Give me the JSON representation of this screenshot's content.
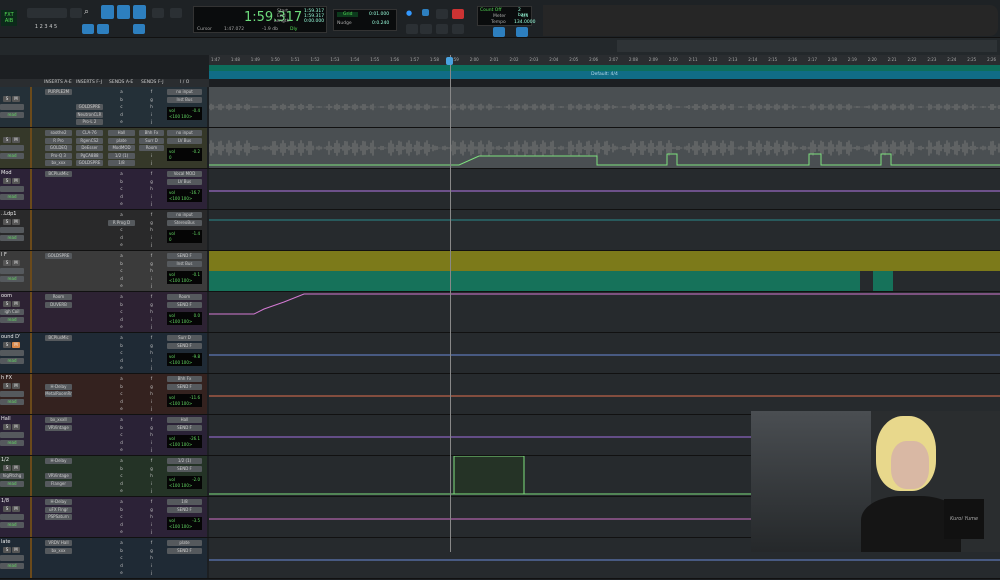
{
  "toolbar": {
    "mode_top": "FXT",
    "mode_bottom": "AIB",
    "zoom_presets": [
      "1",
      "2",
      "3",
      "4",
      "5"
    ],
    "counter": {
      "main": "1:59.317",
      "start_label": "Start",
      "end_label": "End",
      "length_label": "Length",
      "start": "1:59.317",
      "end": "1:59.317",
      "length": "0:00.000",
      "cursor_label": "Cursor",
      "cursor": "1:47.072",
      "level": "-1.9 db",
      "dly_label": "Dly"
    },
    "grid": {
      "label": "Grid",
      "value": "0:01.000",
      "nudge_label": "Nudge",
      "nudge_value": "0:0.240"
    },
    "counts": {
      "count_off": "Count Off",
      "count_off_value": "2 bars",
      "meter_label": "Meter",
      "meter_value": "4/4",
      "tempo_label": "Tempo",
      "tempo_value": "134.0000"
    }
  },
  "ruler": {
    "ticks": [
      "1:47",
      "1:48",
      "1:49",
      "1:50",
      "1:51",
      "1:52",
      "1:53",
      "1:54",
      "1:55",
      "1:56",
      "1:57",
      "1:58",
      "1:59",
      "2:00",
      "2:01",
      "2:02",
      "2:03",
      "2:04",
      "2:05",
      "2:06",
      "2:07",
      "2:08",
      "2:09",
      "2:10",
      "2:11",
      "2:12",
      "2:13",
      "2:14",
      "2:15",
      "2:16",
      "2:17",
      "2:18",
      "2:19",
      "2:20",
      "2:21",
      "2:22",
      "2:23",
      "2:24",
      "2:25",
      "2:26"
    ],
    "tempo_label": "Default: 4/4"
  },
  "columns": {
    "inserts_ae": "INSERTS A-E",
    "inserts_fj": "INSERTS F-J",
    "sends_ae": "SENDS A-E",
    "sends_fj": "SENDS F-J",
    "io": "I / O"
  },
  "send_letters_ae": [
    "a",
    "b",
    "c",
    "d",
    "e"
  ],
  "send_letters_fj": [
    "f",
    "g",
    "h",
    "i",
    "j"
  ],
  "tracks": [
    {
      "name": "",
      "color": "#243038",
      "ins": [
        "PURPLE2M",
        "",
        "",
        "",
        ""
      ],
      "insfj": [
        "",
        "",
        "GOLDSPRE",
        "NeutronCLR",
        "Pro-L 2"
      ],
      "sends": [],
      "sendsfj": [],
      "io": [
        "no input",
        "Inst Bus"
      ],
      "vol": "-0.4",
      "pan": "<100  100>",
      "lane": "wave"
    },
    {
      "name": "",
      "color": "#353829",
      "ins": [
        "soothe2",
        "R Pro",
        "GOLDEQ",
        "Pro-Q 3",
        "bx_xxx"
      ],
      "insfj": [
        "CLA-76",
        "RgenCS2",
        "DeEsser",
        "PgCA888",
        "GOLDSPRE"
      ],
      "sends": [
        "Hall",
        "plate",
        "ModMOD",
        "1/2 (1)",
        "1/8"
      ],
      "sendsfj": [
        "Bhh Fx",
        "Surr D",
        "Room"
      ],
      "io": [
        "no input",
        "LV Bus"
      ],
      "vol": "-0.2",
      "pan": "0",
      "lane": "wave2"
    },
    {
      "name": "Mod",
      "color": "#2c2237",
      "ins": [
        "BCPlusMic"
      ],
      "insfj": [],
      "sends": [],
      "sendsfj": [],
      "io": [
        "Vocal MOD",
        "LV Bus"
      ],
      "vol": "-16.7",
      "pan": "<100  100>",
      "lane": "#b478e6"
    },
    {
      "name": "..Ldp1",
      "color": "#29292a",
      "ins": [],
      "insfj": [],
      "sends": [
        "",
        "R Prog D"
      ],
      "sendsfj": [],
      "io": [
        "no input",
        "StereoBus"
      ],
      "vol": "-1.4",
      "pan": "0",
      "lane": "#2a8a8a"
    },
    {
      "name": "l F",
      "color": "#3b3b3b",
      "ins": [
        "GOLDSPRE"
      ],
      "insfj": [],
      "sends": [],
      "sendsfj": [],
      "io": [
        "SEND F",
        "Inst Bus"
      ],
      "vol": "-0.1",
      "pan": "<100  100>",
      "lane": "clip"
    },
    {
      "name": "oom",
      "sub": "igh Coil",
      "color": "#2d2233",
      "ins": [
        "Room",
        "DUVERB"
      ],
      "insfj": [],
      "sends": [],
      "sendsfj": [],
      "io": [
        "Room",
        "SEND F"
      ],
      "vol": "0.0",
      "pan": "<100  100>",
      "lane": "#d47ad4"
    },
    {
      "name": "ound D'",
      "color": "#1f2a35",
      "ins": [
        "BCPlusMic"
      ],
      "insfj": [],
      "sends": [],
      "sendsfj": [],
      "io": [
        "Surr D",
        "SEND F"
      ],
      "vol": "-9.8",
      "pan": "<100  100>",
      "lane": "#6a8ad8"
    },
    {
      "name": "h FX",
      "color": "#34221f",
      "ins": [
        "",
        "H-Delay",
        "MetalRoomRr"
      ],
      "insfj": [],
      "sends": [],
      "sendsfj": [],
      "io": [
        "Bhh Fx",
        "SEND F"
      ],
      "vol": "-11.6",
      "pan": "<100  100>",
      "lane": "#e07050"
    },
    {
      "name": "Hall",
      "color": "#2a2236",
      "ins": [
        "bx_xxxII",
        "VRVintage"
      ],
      "insfj": [],
      "sends": [],
      "sendsfj": [],
      "io": [
        "Hall",
        "SEND F"
      ],
      "vol": "-26.1",
      "pan": "<100  100>",
      "lane": "#a070e0"
    },
    {
      "name": "1/2",
      "sub": "higPitchg",
      "color": "#243326",
      "ins": [
        "H-Delay",
        "",
        "VRVintage",
        "Flanger"
      ],
      "insfj": [],
      "sends": [],
      "sendsfj": [],
      "io": [
        "1/2 (1)",
        "SEND F"
      ],
      "vol": "-2.0",
      "pan": "<100  100>",
      "lane": "rect"
    },
    {
      "name": "1/8",
      "color": "#2c2237",
      "ins": [
        "H-Delay",
        "uFX Flngr",
        "PSPSaturn"
      ],
      "insfj": [],
      "sends": [],
      "sendsfj": [],
      "io": [
        "1/8",
        "SEND F"
      ],
      "vol": "-3.5",
      "pan": "<100  100>",
      "lane": "#d070c8"
    },
    {
      "name": "late",
      "color": "#1f2a35",
      "ins": [
        "VRDV Hall",
        "bx_xxx"
      ],
      "insfj": [],
      "sends": [],
      "sendsfj": [],
      "io": [
        "plate",
        "SEND F"
      ],
      "vol": "",
      "pan": "",
      "lane": "#6a8ad8"
    }
  ],
  "solo_label": "S",
  "mute_label": "M",
  "vol_label": "vol",
  "pan_label": "pan",
  "read_label": "read",
  "webcam": {
    "watermark": "Kuroi Yume"
  }
}
